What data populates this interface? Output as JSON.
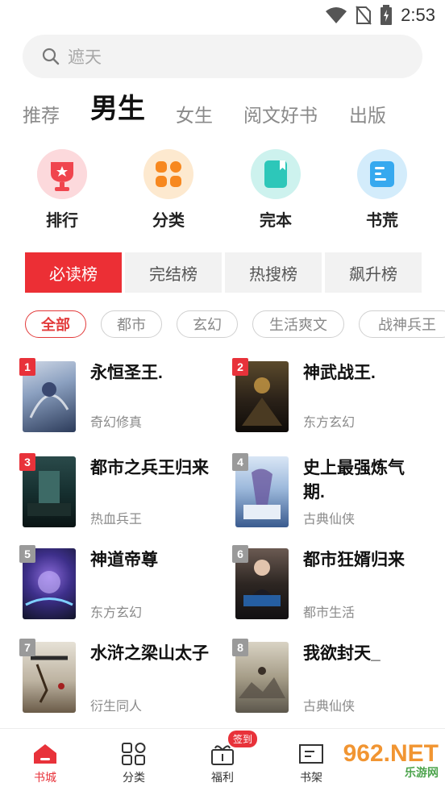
{
  "status_bar": {
    "time": "2:53"
  },
  "search": {
    "placeholder": "遮天"
  },
  "channel_tabs": [
    {
      "label": "推荐",
      "active": false
    },
    {
      "label": "男生",
      "active": true
    },
    {
      "label": "女生",
      "active": false
    },
    {
      "label": "阅文好书",
      "active": false
    },
    {
      "label": "出版",
      "active": false
    }
  ],
  "categories": [
    {
      "label": "排行",
      "icon": "trophy-icon",
      "color": "#f0454e"
    },
    {
      "label": "分类",
      "icon": "grid-icon",
      "color": "#f7881f"
    },
    {
      "label": "完本",
      "icon": "book-icon",
      "color": "#2dc7b9"
    },
    {
      "label": "书荒",
      "icon": "notebook-icon",
      "color": "#37a9ef"
    }
  ],
  "rank_tabs": [
    {
      "label": "必读榜",
      "active": true
    },
    {
      "label": "完结榜",
      "active": false
    },
    {
      "label": "热搜榜",
      "active": false
    },
    {
      "label": "飙升榜",
      "active": false
    }
  ],
  "filter_chips": [
    {
      "label": "全部",
      "active": true
    },
    {
      "label": "都市",
      "active": false
    },
    {
      "label": "玄幻",
      "active": false
    },
    {
      "label": "生活爽文",
      "active": false
    },
    {
      "label": "战神兵王",
      "active": false
    }
  ],
  "books": [
    {
      "rank": "1",
      "title": "永恒圣王.",
      "genre": "奇幻修真"
    },
    {
      "rank": "2",
      "title": "神武战王.",
      "genre": "东方玄幻"
    },
    {
      "rank": "3",
      "title": "都市之兵王归来",
      "genre": "热血兵王"
    },
    {
      "rank": "4",
      "title": "史上最强炼气期.",
      "genre": "古典仙侠"
    },
    {
      "rank": "5",
      "title": "神道帝尊",
      "genre": "东方玄幻"
    },
    {
      "rank": "6",
      "title": "都市狂婿归来",
      "genre": "都市生活"
    },
    {
      "rank": "7",
      "title": "水浒之梁山太子",
      "genre": "衍生同人"
    },
    {
      "rank": "8",
      "title": "我欲封天_",
      "genre": "古典仙侠"
    }
  ],
  "bottom_nav": [
    {
      "label": "书城",
      "icon": "home-icon",
      "active": true
    },
    {
      "label": "分类",
      "icon": "category-icon",
      "active": false
    },
    {
      "label": "福利",
      "icon": "gift-icon",
      "active": false,
      "badge": "签到"
    },
    {
      "label": "书架",
      "icon": "bookshelf-icon",
      "active": false
    }
  ],
  "watermark": {
    "brand": "962.NET",
    "sub": "乐游网"
  },
  "colors": {
    "accent": "#e8323a",
    "muted": "#8a8a8a"
  }
}
